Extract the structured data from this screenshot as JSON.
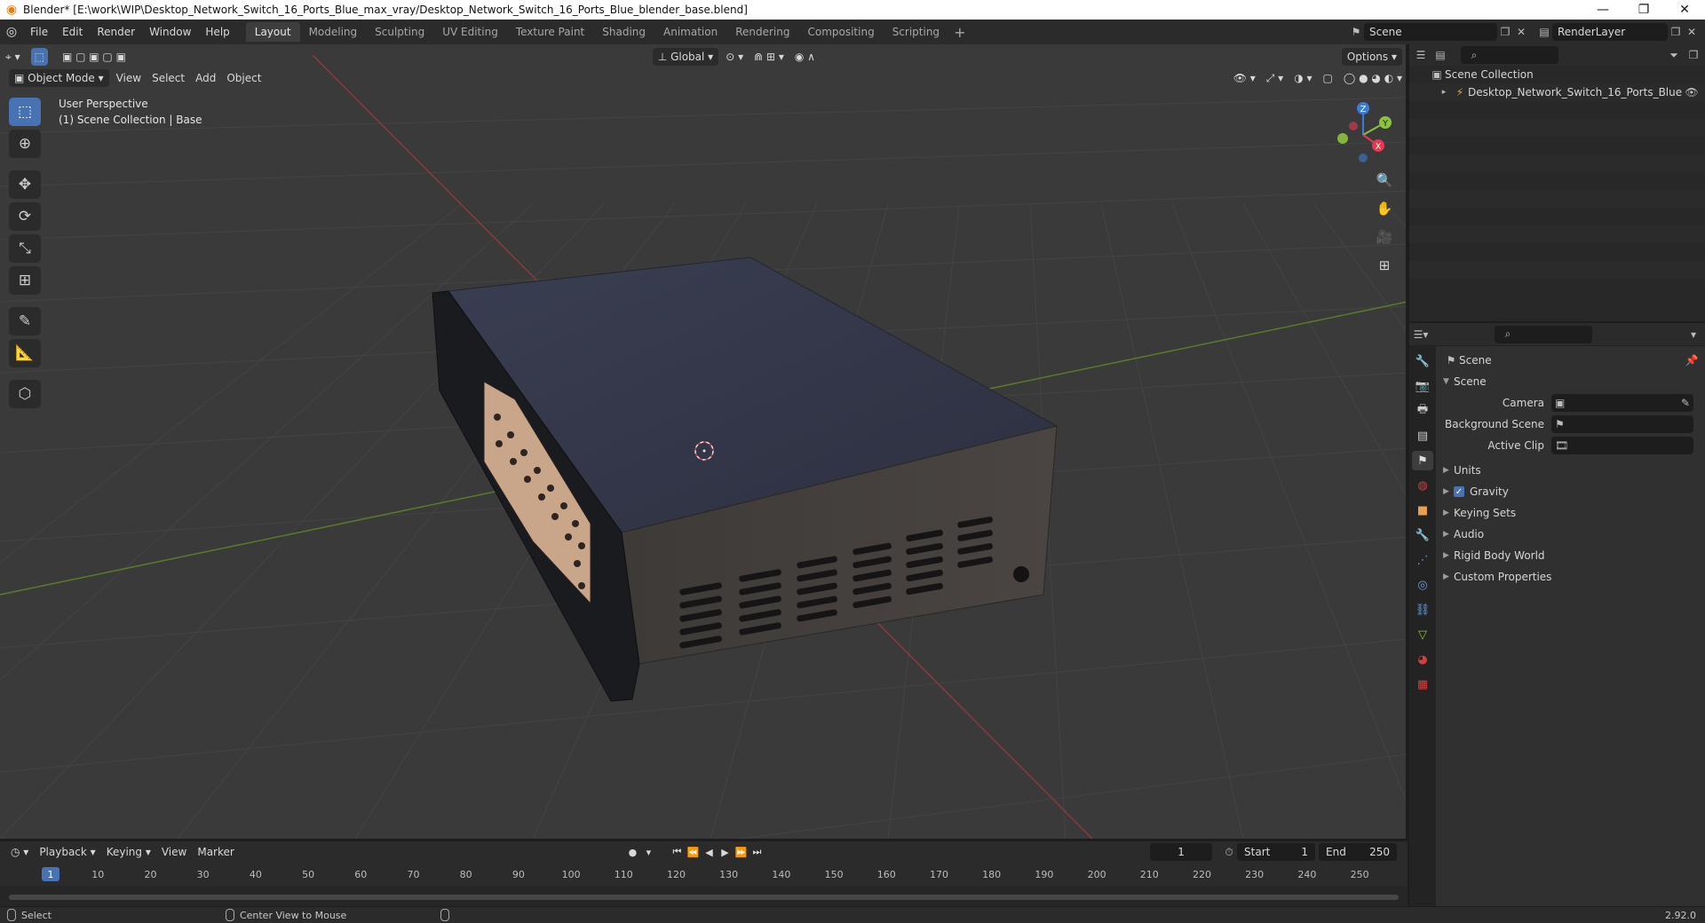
{
  "window": {
    "title": "Blender* [E:\\work\\WIP\\Desktop_Network_Switch_16_Ports_Blue_max_vray/Desktop_Network_Switch_16_Ports_Blue_blender_base.blend]",
    "minimize": "—",
    "restore": "❐",
    "close": "✕"
  },
  "menubar": {
    "menus": [
      "File",
      "Edit",
      "Render",
      "Window",
      "Help"
    ],
    "workspaces": [
      "Layout",
      "Modeling",
      "Sculpting",
      "UV Editing",
      "Texture Paint",
      "Shading",
      "Animation",
      "Rendering",
      "Compositing",
      "Scripting"
    ],
    "active_workspace": "Layout",
    "add_tab": "+",
    "scene": "Scene",
    "view_layer": "RenderLayer"
  },
  "viewport": {
    "mode": "Object Mode",
    "menus": [
      "View",
      "Select",
      "Add",
      "Object"
    ],
    "transform_orientation": "Global",
    "options": "Options",
    "overlay_line1": "User Perspective",
    "overlay_line2": "(1) Scene Collection | Base",
    "gizmo": {
      "x": "X",
      "y": "Y",
      "z": "Z"
    }
  },
  "outliner": {
    "root": "Scene Collection",
    "items": [
      "Desktop_Network_Switch_16_Ports_Blue"
    ]
  },
  "properties": {
    "context": "Scene",
    "panel": "Scene",
    "fields": [
      {
        "label": "Camera"
      },
      {
        "label": "Background Scene"
      },
      {
        "label": "Active Clip"
      }
    ],
    "subpanels": [
      "Units",
      "Gravity",
      "Keying Sets",
      "Audio",
      "Rigid Body World",
      "Custom Properties"
    ],
    "gravity_checked": true
  },
  "timeline": {
    "menus": [
      "Playback",
      "Keying",
      "View",
      "Marker"
    ],
    "current_frame": "1",
    "start_label": "Start",
    "start": "1",
    "end_label": "End",
    "end": "250",
    "ruler": [
      "1",
      "10",
      "20",
      "30",
      "40",
      "50",
      "60",
      "70",
      "80",
      "90",
      "100",
      "110",
      "120",
      "130",
      "140",
      "150",
      "160",
      "170",
      "180",
      "190",
      "200",
      "210",
      "220",
      "230",
      "240",
      "250"
    ]
  },
  "statusbar": {
    "select": "Select",
    "center_view": "Center View to Mouse",
    "version": "2.92.0"
  },
  "colors": {
    "accent": "#4772b3",
    "x_axis": "#e8384f",
    "y_axis": "#8cc23f",
    "z_axis": "#3c7bd6"
  }
}
